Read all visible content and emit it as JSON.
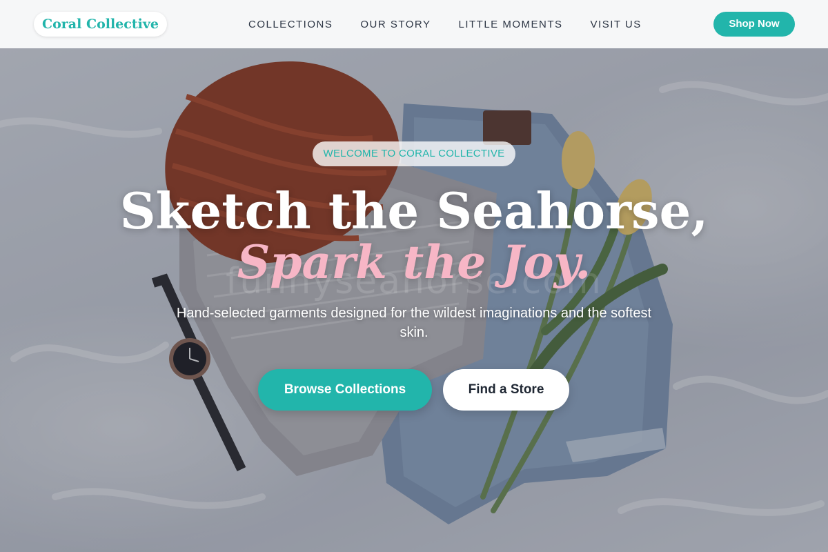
{
  "brand": {
    "name": "Coral Collective"
  },
  "nav": {
    "items": [
      {
        "label": "COLLECTIONS"
      },
      {
        "label": "OUR STORY"
      },
      {
        "label": "LITTLE MOMENTS"
      },
      {
        "label": "VISIT US"
      }
    ],
    "cta_label": "Shop Now"
  },
  "hero": {
    "badge": "WELCOME TO CORAL COLLECTIVE",
    "headline": "Sketch the Seahorse,",
    "headline_accent": "Spark the Joy.",
    "subtitle": "Hand-selected garments designed for the wildest imaginations and the softest skin.",
    "primary_button": "Browse Collections",
    "secondary_button": "Find a Store",
    "watermark": "funnyseahorse.com"
  },
  "colors": {
    "accent": "#22b5ab",
    "highlight_pink": "#f7b6c6",
    "nav_text": "#2c3544",
    "topbar_bg": "#f6f7f8"
  },
  "icons": [
    "beanie-image",
    "sweater-image",
    "jeans-image",
    "tulips-image",
    "wristwatch-image"
  ]
}
